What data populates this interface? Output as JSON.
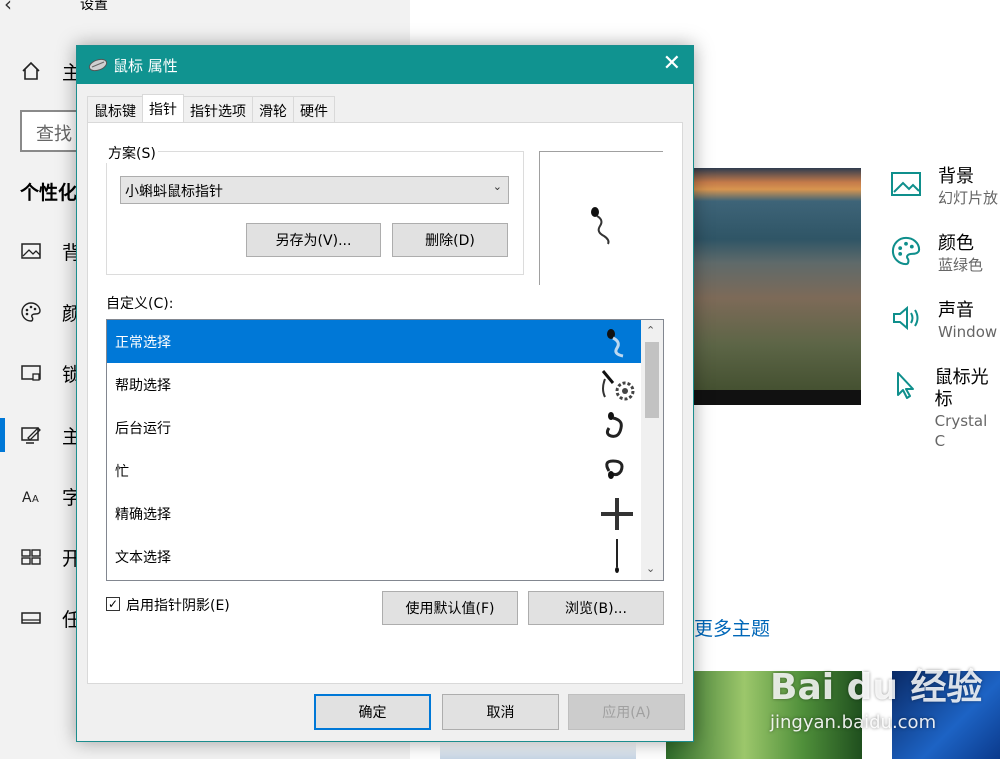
{
  "settings": {
    "title": "设置",
    "search_placeholder": "查找",
    "section": "个性化",
    "nav": [
      {
        "label": "主"
      },
      {
        "label": "背"
      },
      {
        "label": "颜"
      },
      {
        "label": "锁"
      },
      {
        "label": "主"
      },
      {
        "label": "字"
      },
      {
        "label": "开"
      },
      {
        "label": "任"
      }
    ],
    "related": [
      {
        "title": "背景",
        "sub": "幻灯片放"
      },
      {
        "title": "颜色",
        "sub": "蓝绿色"
      },
      {
        "title": "声音",
        "sub": "Window"
      },
      {
        "title": "鼠标光标",
        "sub": "Crystal C"
      }
    ],
    "more_themes": "更多主题",
    "accent_color": "#0078d7",
    "watermark": "Bai du 经验",
    "watermark_url": "jingyan.baidu.com"
  },
  "dialog": {
    "title": "鼠标 属性",
    "titlebar_color": "#109390",
    "tabs": [
      "鼠标键",
      "指针",
      "指针选项",
      "滑轮",
      "硬件"
    ],
    "active_tab": "指针",
    "scheme_label": "方案(S)",
    "scheme_value": "小蝌蚪鼠标指针",
    "save_as": "另存为(V)...",
    "delete": "删除(D)",
    "custom_label": "自定义(C):",
    "cursors": [
      {
        "label": "正常选择",
        "icon": "tadpole-arrow",
        "selected": true
      },
      {
        "label": "帮助选择",
        "icon": "tadpole-help"
      },
      {
        "label": "后台运行",
        "icon": "tadpole-working"
      },
      {
        "label": "忙",
        "icon": "tadpole-busy"
      },
      {
        "label": "精确选择",
        "icon": "crosshair"
      },
      {
        "label": "文本选择",
        "icon": "text-beam"
      }
    ],
    "shadow_checkbox": "启用指针阴影(E)",
    "shadow_checked": true,
    "use_default": "使用默认值(F)",
    "browse": "浏览(B)...",
    "ok": "确定",
    "cancel": "取消",
    "apply": "应用(A)"
  }
}
